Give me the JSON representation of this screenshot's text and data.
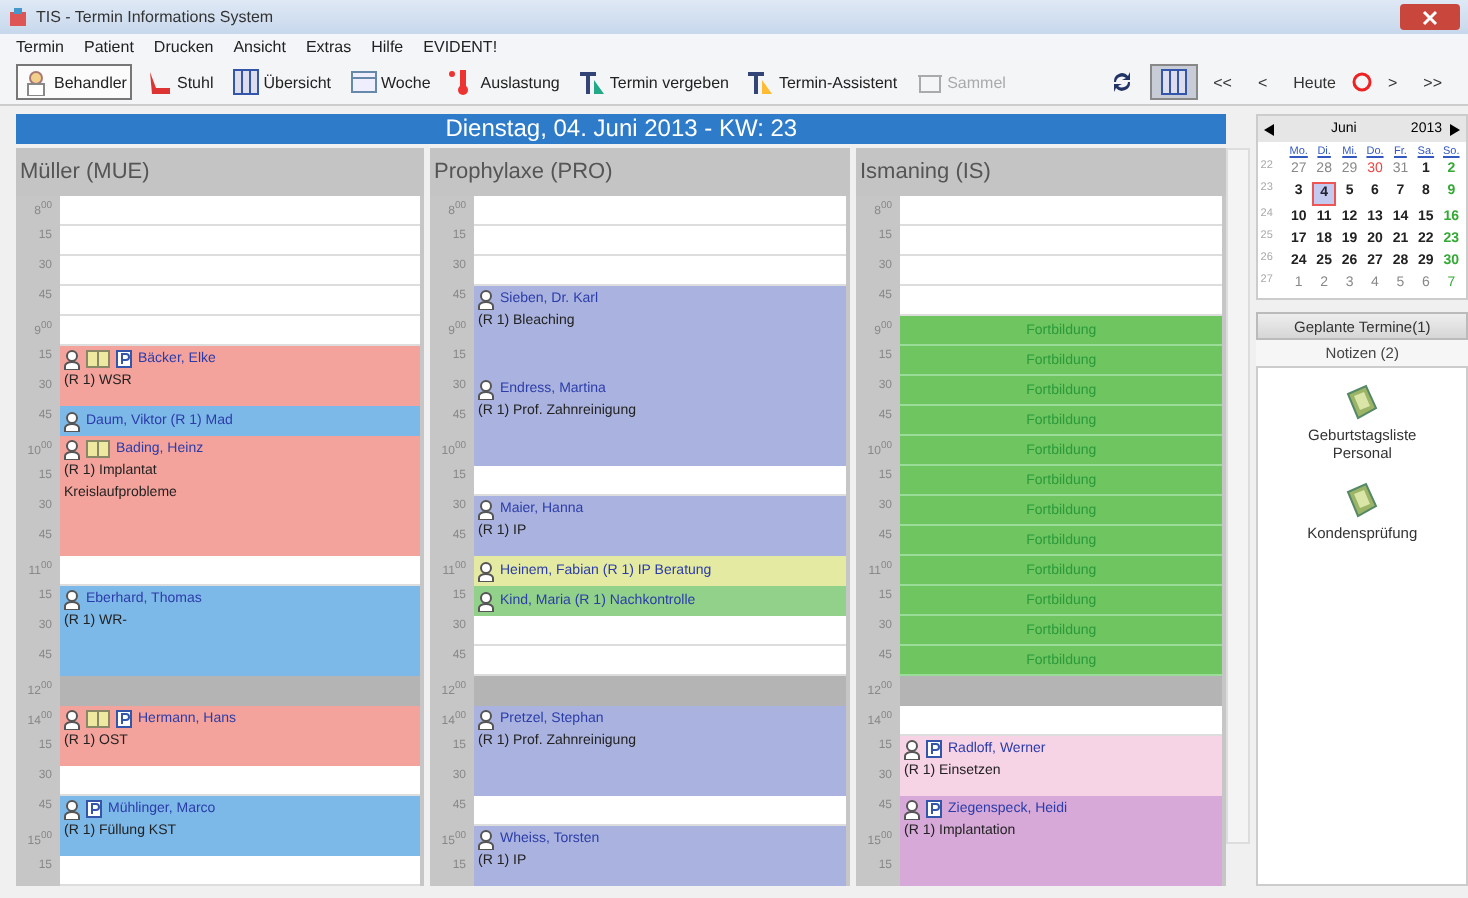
{
  "window": {
    "title": "TIS - Termin Informations System"
  },
  "menu": [
    "Termin",
    "Patient",
    "Drucken",
    "Ansicht",
    "Extras",
    "Hilfe",
    "EVIDENT!"
  ],
  "toolbar": [
    {
      "label": "Behandler",
      "kind": "person",
      "selected": true,
      "disabled": false
    },
    {
      "label": "Stuhl",
      "kind": "chair",
      "selected": false,
      "disabled": false
    },
    {
      "label": "Übersicht",
      "kind": "columns",
      "selected": false,
      "disabled": false
    },
    {
      "label": "Woche",
      "kind": "week",
      "selected": false,
      "disabled": false
    },
    {
      "label": "Auslastung",
      "kind": "thermo",
      "selected": false,
      "disabled": false
    },
    {
      "label": "Termin vergeben",
      "kind": "assign",
      "selected": false,
      "disabled": false
    },
    {
      "label": "Termin-Assistent",
      "kind": "assist",
      "selected": false,
      "disabled": false
    },
    {
      "label": "Sammel",
      "kind": "collect",
      "selected": false,
      "disabled": true
    }
  ],
  "nav": {
    "first": "<<",
    "prev": "<",
    "today": "Heute",
    "next": ">",
    "last": ">>"
  },
  "date_bar": "Dienstag, 04. Juni 2013 - KW: 23",
  "columns": [
    {
      "title": "Müller (MUE)",
      "blocks": [
        {
          "kind": "free",
          "times": [
            "8$^{00}$",
            "15",
            "30",
            "45",
            "9$^{00}$"
          ]
        },
        {
          "kind": "block",
          "times": [
            "15",
            "30"
          ],
          "color": "#f4a39c",
          "name": "Bäcker, Elke",
          "lines": [
            "(R 1) WSR"
          ],
          "book": true,
          "parking": true
        },
        {
          "kind": "inline",
          "times": [
            "45"
          ],
          "color": "#7db9e8",
          "name": "Daum, Viktor (R 1) Mad",
          "book": false,
          "parking": false
        },
        {
          "kind": "block",
          "times": [
            "10$^{00}$",
            "15",
            "30",
            "45"
          ],
          "color": "#f4a39c",
          "name": "Bading, Heinz",
          "lines": [
            "(R 1) Implantat",
            "Kreislaufprobleme"
          ],
          "book": true,
          "parking": false
        },
        {
          "kind": "free",
          "times": [
            "11$^{00}$"
          ]
        },
        {
          "kind": "block",
          "times": [
            "15",
            "30",
            "45"
          ],
          "color": "#7db9e8",
          "name": "Eberhard, Thomas",
          "lines": [
            "(R 1) WR-"
          ],
          "book": false,
          "parking": false
        },
        {
          "kind": "break",
          "times": [
            "12$^{00}$"
          ]
        },
        {
          "kind": "block",
          "times": [
            "14$^{00}$",
            "15"
          ],
          "color": "#f4a39c",
          "name": "Hermann, Hans",
          "lines": [
            "(R 1) OST"
          ],
          "book": true,
          "parking": true
        },
        {
          "kind": "free",
          "times": [
            "30"
          ]
        },
        {
          "kind": "block",
          "times": [
            "45",
            "15$^{00}$"
          ],
          "color": "#7db9e8",
          "name": "Mühlinger, Marco",
          "lines": [
            "(R 1) Füllung KST"
          ],
          "book": false,
          "parking": true
        },
        {
          "kind": "free",
          "times": [
            "15"
          ]
        }
      ]
    },
    {
      "title": "Prophylaxe (PRO)",
      "blocks": [
        {
          "kind": "free",
          "times": [
            "8$^{00}$",
            "15",
            "30"
          ]
        },
        {
          "kind": "block",
          "times": [
            "45",
            "9$^{00}$",
            "15"
          ],
          "color": "#aab3df",
          "name": "Sieben, Dr. Karl",
          "lines": [
            "(R 1) Bleaching"
          ],
          "book": false,
          "parking": false
        },
        {
          "kind": "block",
          "times": [
            "30",
            "45",
            "10$^{00}$"
          ],
          "color": "#aab3df",
          "name": "Endress, Martina",
          "lines": [
            "(R 1) Prof. Zahnreinigung"
          ],
          "book": false,
          "parking": false
        },
        {
          "kind": "free",
          "times": [
            "15"
          ]
        },
        {
          "kind": "block",
          "times": [
            "30",
            "45"
          ],
          "color": "#aab3df",
          "name": "Maier, Hanna",
          "lines": [
            "(R 1) IP"
          ],
          "book": false,
          "parking": false
        },
        {
          "kind": "inline",
          "times": [
            "11$^{00}$"
          ],
          "color": "#e4eaa2",
          "name": "Heinem, Fabian (R 1) IP Beratung",
          "book": false,
          "parking": false
        },
        {
          "kind": "inline",
          "times": [
            "15"
          ],
          "color": "#92d18a",
          "name": "Kind, Maria (R 1) Nachkontrolle",
          "book": false,
          "parking": false
        },
        {
          "kind": "free",
          "times": [
            "30",
            "45"
          ]
        },
        {
          "kind": "break",
          "times": [
            "12$^{00}$"
          ]
        },
        {
          "kind": "block",
          "times": [
            "14$^{00}$",
            "15",
            "30"
          ],
          "color": "#aab3df",
          "name": "Pretzel, Stephan",
          "lines": [
            "(R 1) Prof. Zahnreinigung"
          ],
          "book": false,
          "parking": false
        },
        {
          "kind": "free",
          "times": [
            "45"
          ]
        },
        {
          "kind": "block",
          "times": [
            "15$^{00}$",
            "15"
          ],
          "color": "#aab3df",
          "name": "Wheiss, Torsten",
          "lines": [
            "(R 1) IP"
          ],
          "book": false,
          "parking": false
        }
      ]
    },
    {
      "title": "Ismaning (IS)",
      "blocks": [
        {
          "kind": "free",
          "times": [
            "8$^{00}$",
            "15",
            "30",
            "45"
          ]
        },
        {
          "kind": "label",
          "times": [
            "9$^{00}$"
          ],
          "color": "#6fc55f",
          "name": "Fortbildung"
        },
        {
          "kind": "label",
          "times": [
            "15"
          ],
          "color": "#6fc55f",
          "name": "Fortbildung"
        },
        {
          "kind": "label",
          "times": [
            "30"
          ],
          "color": "#6fc55f",
          "name": "Fortbildung"
        },
        {
          "kind": "label",
          "times": [
            "45"
          ],
          "color": "#6fc55f",
          "name": "Fortbildung"
        },
        {
          "kind": "label",
          "times": [
            "10$^{00}$"
          ],
          "color": "#6fc55f",
          "name": "Fortbildung"
        },
        {
          "kind": "label",
          "times": [
            "15"
          ],
          "color": "#6fc55f",
          "name": "Fortbildung"
        },
        {
          "kind": "label",
          "times": [
            "30"
          ],
          "color": "#6fc55f",
          "name": "Fortbildung"
        },
        {
          "kind": "label",
          "times": [
            "45"
          ],
          "color": "#6fc55f",
          "name": "Fortbildung"
        },
        {
          "kind": "label",
          "times": [
            "11$^{00}$"
          ],
          "color": "#6fc55f",
          "name": "Fortbildung"
        },
        {
          "kind": "label",
          "times": [
            "15"
          ],
          "color": "#6fc55f",
          "name": "Fortbildung"
        },
        {
          "kind": "label",
          "times": [
            "30"
          ],
          "color": "#6fc55f",
          "name": "Fortbildung"
        },
        {
          "kind": "label",
          "times": [
            "45"
          ],
          "color": "#6fc55f",
          "name": "Fortbildung"
        },
        {
          "kind": "break",
          "times": [
            "12$^{00}$"
          ]
        },
        {
          "kind": "free",
          "times": [
            "14$^{00}$"
          ]
        },
        {
          "kind": "block",
          "times": [
            "15",
            "30"
          ],
          "color": "#f7d3e6",
          "name": "Radloff, Werner",
          "lines": [
            "(R 1) Einsetzen"
          ],
          "book": false,
          "parking": true
        },
        {
          "kind": "block",
          "times": [
            "45",
            "15$^{00}$",
            "15"
          ],
          "color": "#d7a9d9",
          "name": "Ziegenspeck, Heidi",
          "lines": [
            "(R 1) Implantation"
          ],
          "book": false,
          "parking": true
        }
      ]
    }
  ],
  "calendar": {
    "month": "Juni",
    "year": "2013",
    "weekdays": [
      "Mo.",
      "Di.",
      "Mi.",
      "Do.",
      "Fr.",
      "Sa.",
      "So."
    ],
    "weeks": [
      {
        "kw": "22",
        "days": [
          {
            "d": "27",
            "muted": true,
            "holiday": false,
            "selected": false
          },
          {
            "d": "28",
            "muted": true,
            "holiday": false,
            "selected": false
          },
          {
            "d": "29",
            "muted": true,
            "holiday": false,
            "selected": false
          },
          {
            "d": "30",
            "muted": true,
            "holiday": true,
            "selected": false
          },
          {
            "d": "31",
            "muted": true,
            "holiday": false,
            "selected": false
          },
          {
            "d": "1",
            "muted": false,
            "holiday": false,
            "selected": false
          },
          {
            "d": "2",
            "muted": false,
            "holiday": false,
            "selected": false
          }
        ]
      },
      {
        "kw": "23",
        "days": [
          {
            "d": "3",
            "muted": false,
            "holiday": false,
            "selected": false
          },
          {
            "d": "4",
            "muted": false,
            "holiday": false,
            "selected": true
          },
          {
            "d": "5",
            "muted": false,
            "holiday": false,
            "selected": false
          },
          {
            "d": "6",
            "muted": false,
            "holiday": false,
            "selected": false
          },
          {
            "d": "7",
            "muted": false,
            "holiday": false,
            "selected": false
          },
          {
            "d": "8",
            "muted": false,
            "holiday": false,
            "selected": false
          },
          {
            "d": "9",
            "muted": false,
            "holiday": false,
            "selected": false
          }
        ]
      },
      {
        "kw": "24",
        "days": [
          {
            "d": "10",
            "muted": false,
            "holiday": false,
            "selected": false
          },
          {
            "d": "11",
            "muted": false,
            "holiday": false,
            "selected": false
          },
          {
            "d": "12",
            "muted": false,
            "holiday": false,
            "selected": false
          },
          {
            "d": "13",
            "muted": false,
            "holiday": false,
            "selected": false
          },
          {
            "d": "14",
            "muted": false,
            "holiday": false,
            "selected": false
          },
          {
            "d": "15",
            "muted": false,
            "holiday": false,
            "selected": false
          },
          {
            "d": "16",
            "muted": false,
            "holiday": false,
            "selected": false
          }
        ]
      },
      {
        "kw": "25",
        "days": [
          {
            "d": "17",
            "muted": false,
            "holiday": false,
            "selected": false
          },
          {
            "d": "18",
            "muted": false,
            "holiday": false,
            "selected": false
          },
          {
            "d": "19",
            "muted": false,
            "holiday": false,
            "selected": false
          },
          {
            "d": "20",
            "muted": false,
            "holiday": false,
            "selected": false
          },
          {
            "d": "21",
            "muted": false,
            "holiday": false,
            "selected": false
          },
          {
            "d": "22",
            "muted": false,
            "holiday": false,
            "selected": false
          },
          {
            "d": "23",
            "muted": false,
            "holiday": false,
            "selected": false
          }
        ]
      },
      {
        "kw": "26",
        "days": [
          {
            "d": "24",
            "muted": false,
            "holiday": false,
            "selected": false
          },
          {
            "d": "25",
            "muted": false,
            "holiday": false,
            "selected": false
          },
          {
            "d": "26",
            "muted": false,
            "holiday": false,
            "selected": false
          },
          {
            "d": "27",
            "muted": false,
            "holiday": false,
            "selected": false
          },
          {
            "d": "28",
            "muted": false,
            "holiday": false,
            "selected": false
          },
          {
            "d": "29",
            "muted": false,
            "holiday": false,
            "selected": false
          },
          {
            "d": "30",
            "muted": false,
            "holiday": false,
            "selected": false
          }
        ]
      },
      {
        "kw": "27",
        "days": [
          {
            "d": "1",
            "muted": true,
            "holiday": false,
            "selected": false
          },
          {
            "d": "2",
            "muted": true,
            "holiday": false,
            "selected": false
          },
          {
            "d": "3",
            "muted": true,
            "holiday": false,
            "selected": false
          },
          {
            "d": "4",
            "muted": true,
            "holiday": false,
            "selected": false
          },
          {
            "d": "5",
            "muted": true,
            "holiday": false,
            "selected": false
          },
          {
            "d": "6",
            "muted": true,
            "holiday": false,
            "selected": false
          },
          {
            "d": "7",
            "muted": true,
            "holiday": false,
            "selected": false
          }
        ]
      }
    ]
  },
  "planned_button": "Geplante Termine(1)",
  "notes_tab": "Notizen (2)",
  "notes": [
    {
      "label": "Geburtstagsliste Personal"
    },
    {
      "label": "Kondensprüfung"
    }
  ]
}
